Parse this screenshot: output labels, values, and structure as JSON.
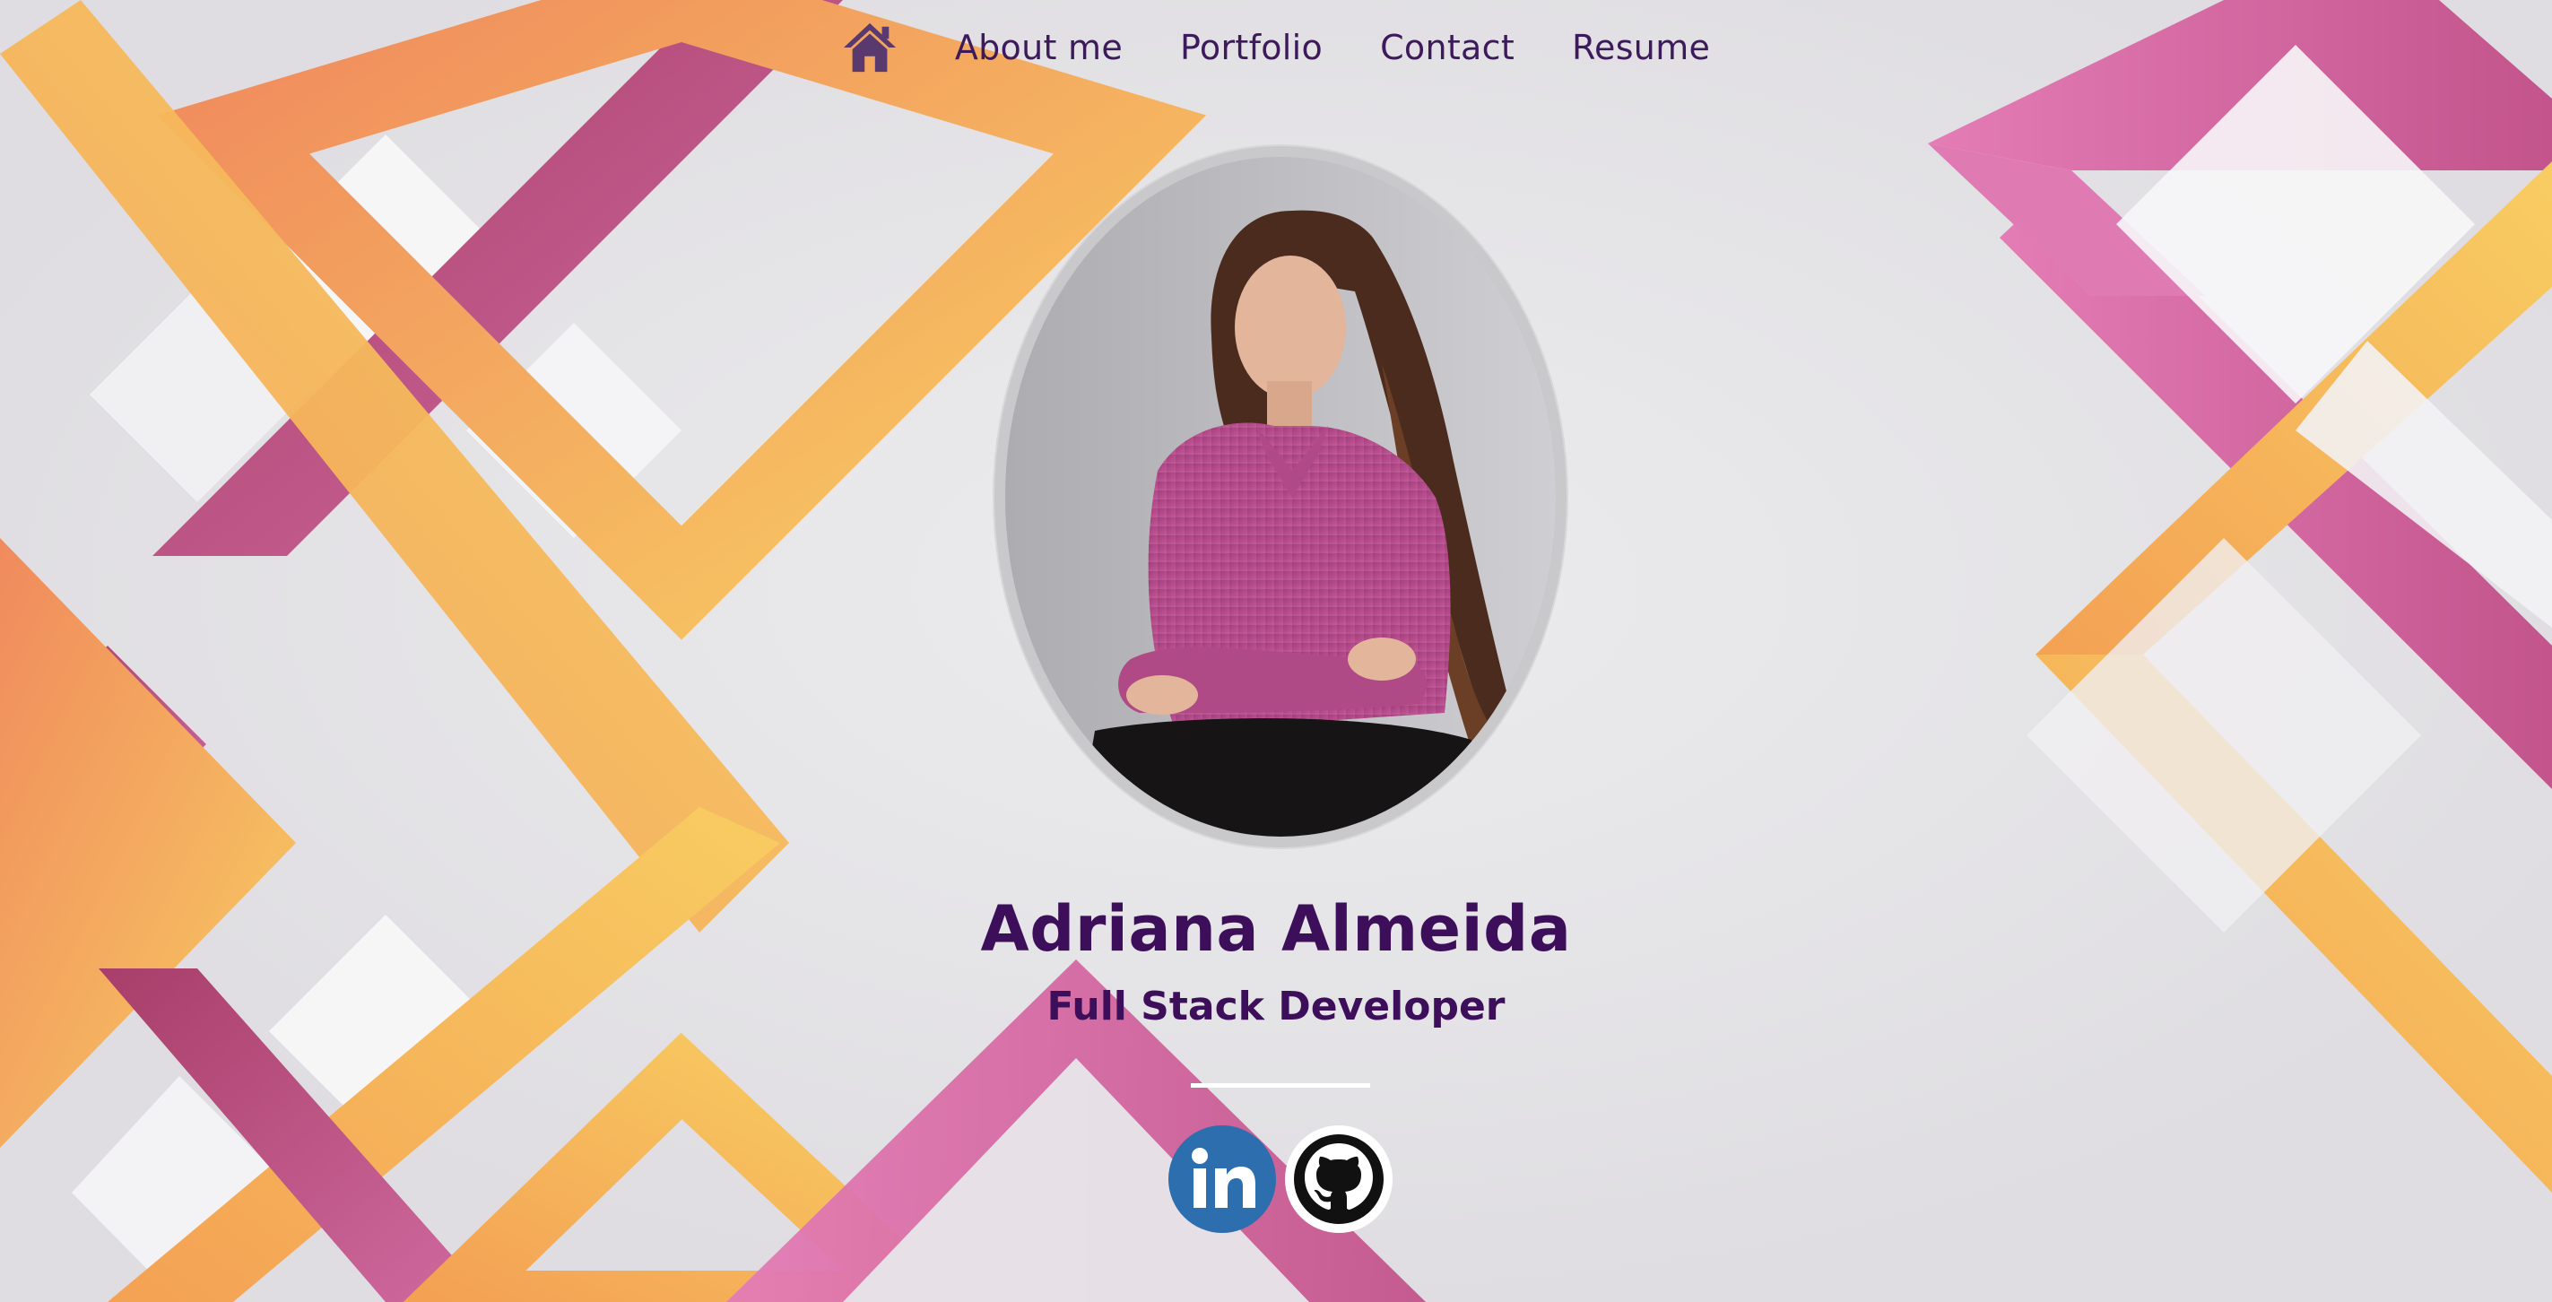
{
  "nav": {
    "home_icon": "house-icon",
    "items": [
      {
        "label": "About me"
      },
      {
        "label": "Portfolio"
      },
      {
        "label": "Contact"
      },
      {
        "label": "Resume"
      }
    ]
  },
  "profile": {
    "name": "Adriana Almeida",
    "role": "Full Stack Developer",
    "photo_icon": "portrait-photo"
  },
  "socials": [
    {
      "icon": "linkedin-icon",
      "label": "in"
    },
    {
      "icon": "github-icon"
    }
  ],
  "colors": {
    "text_primary": "#3d0f5a",
    "nav_text": "#3d1a5b",
    "linkedin": "#2d6eae",
    "accent_orange": "#f3a64d",
    "accent_pink": "#c85a94",
    "accent_magenta": "#a83e69",
    "background": "#ebe9ec"
  }
}
